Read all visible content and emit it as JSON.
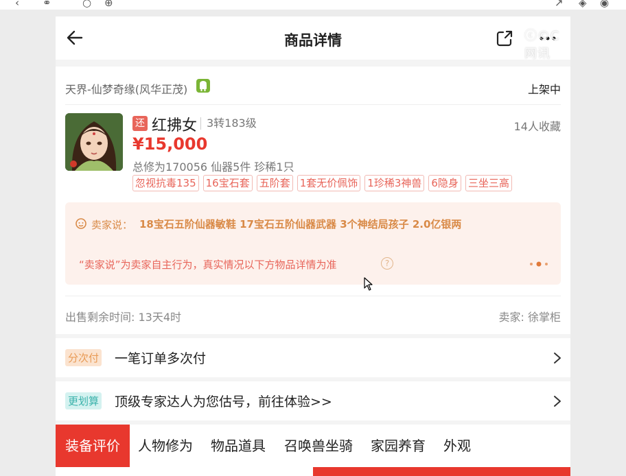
{
  "colors": {
    "accent": "#e8382e",
    "tag": "#e8655a",
    "seller_text": "#d98a47"
  },
  "browser_icons": [
    "chevron-left-icon",
    "link-icon",
    "refresh-icon",
    "globe-icon",
    "share-icon",
    "cube-icon",
    "profile-icon"
  ],
  "header": {
    "title": "商品详情",
    "watermark": "ⓒ©C网讯"
  },
  "item": {
    "server": "天界-仙梦奇缘(风华正茂)",
    "status": "上架中",
    "role_badge": "还",
    "role_name": "红拂女",
    "role_level": "3转183级",
    "favorites": "14人收藏",
    "price": "¥15,000",
    "stats": "总修为170056  仙器5件  珍稀1只",
    "tags": [
      "忽视抗毒135",
      "16宝石套",
      "五阶套",
      "1套无价佩饰",
      "1珍稀3神兽",
      "6隐身",
      "三坐三高"
    ]
  },
  "seller_box": {
    "label": "卖家说：",
    "text": "18宝石五阶仙器敏鞋 17宝石五阶仙器武器 3个神结局孩子 2.0亿银两",
    "note": "“卖家说”为卖家自主行为，真实情况以下方物品详情为准",
    "help": "?"
  },
  "footer": {
    "time_left": "出售剩余时间: 13天4时",
    "seller": "卖家: 徐掌柜"
  },
  "rows": [
    {
      "badge": "分次付",
      "text": "一笔订单多次付"
    },
    {
      "badge": "更划算",
      "text": "顶级专家达人为您估号，前往体验>>"
    }
  ],
  "tabs": [
    "装备评价",
    "人物修为",
    "物品道具",
    "召唤兽坐骑",
    "家园养育",
    "外观"
  ]
}
